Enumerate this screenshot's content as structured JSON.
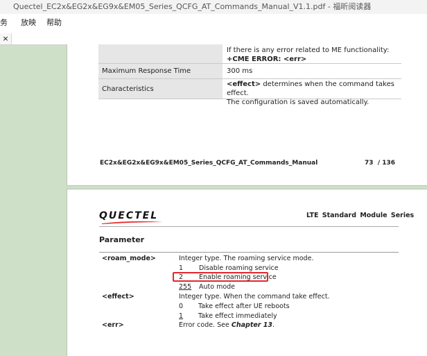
{
  "window": {
    "title": "Quectel_EC2x&EG2x&EG9x&EM05_Series_QCFG_AT_Commands_Manual_V1.1.pdf - 福昕阅读器"
  },
  "menu": {
    "items": [
      "务",
      "放映",
      "帮助"
    ]
  },
  "tab": {
    "close_label": "×"
  },
  "page1": {
    "table": [
      {
        "label": "",
        "lines": [
          "If there is any error related to ME functionality:",
          "+CME ERROR: <err>"
        ]
      },
      {
        "label": "Maximum Response Time",
        "lines": [
          "300 ms"
        ]
      },
      {
        "label": "Characteristics",
        "lines": [
          "<effect> determines when the command takes effect.",
          "The configuration is saved automatically."
        ]
      }
    ],
    "footer": {
      "doc": "EC2x&EG2x&EG9x&EM05_Series_QCFG_AT_Commands_Manual",
      "page": "73",
      "total": "/ 136"
    }
  },
  "page2": {
    "logo": "QUECTEL",
    "series": "LTE Standard Module Series",
    "section": "Parameter",
    "params": {
      "roam_mode": {
        "name": "<roam_mode>",
        "desc": "Integer type. The roaming service mode.",
        "options": [
          {
            "value": "1",
            "text": "Disable roaming service"
          },
          {
            "value": "2",
            "text": "Enable roaming service"
          },
          {
            "value": "255",
            "text": "Auto mode"
          }
        ]
      },
      "effect": {
        "name": "<effect>",
        "desc": "Integer type. When the command take effect.",
        "options": [
          {
            "value": "0",
            "text": "Take effect after UE reboots"
          },
          {
            "value": "1",
            "text": "Take effect immediately"
          }
        ]
      },
      "err": {
        "name": "<err>",
        "desc_prefix": "Error code. See ",
        "desc_ref": "Chapter 13",
        "desc_suffix": "."
      }
    }
  },
  "colors": {
    "background": "#cfe0c9",
    "highlight": "#e3262b"
  }
}
